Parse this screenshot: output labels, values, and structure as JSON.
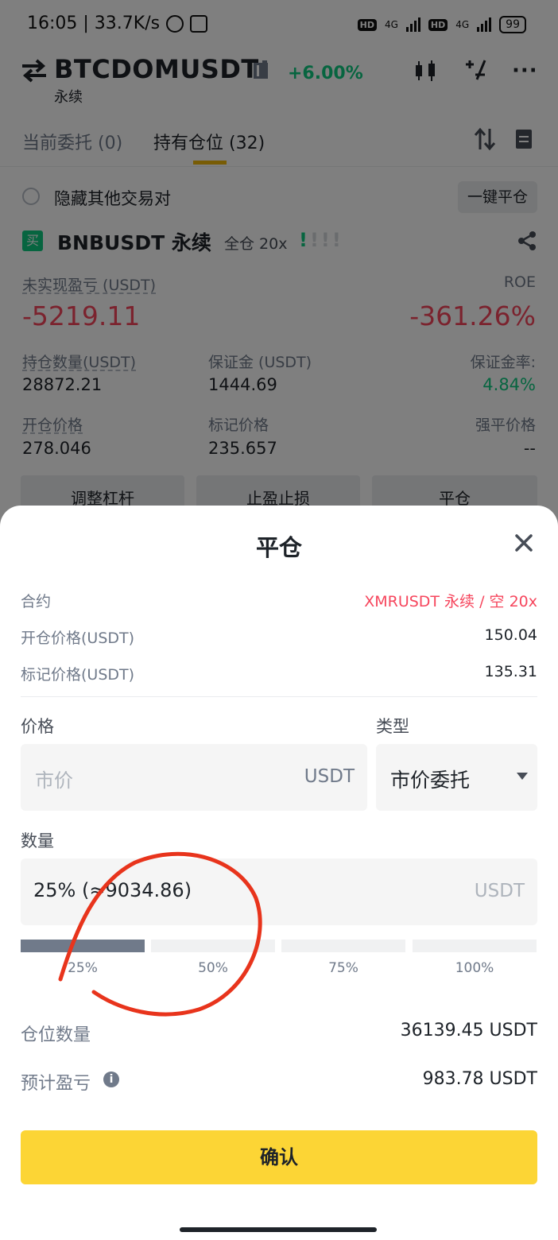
{
  "status_bar": {
    "time_speed": "16:05 | 33.7K/s",
    "hd1": "HD",
    "net1": "4G",
    "hd2": "HD",
    "net2": "4G",
    "battery": "99"
  },
  "header": {
    "pair": "BTCDOMUSDT",
    "subtitle": "永续",
    "change": "+6.00%",
    "more": "···"
  },
  "tabs": {
    "open_orders": "当前委托 (0)",
    "positions": "持有仓位 (32)"
  },
  "filter": {
    "hide_label": "隐藏其他交易对",
    "close_all": "一键平仓"
  },
  "position": {
    "badge": "买",
    "symbol": "BNBUSDT 永续",
    "mode": "全仓 20x",
    "risk_on": "!",
    "risk_off": "!!!",
    "unrealized_label": "未实现盈亏 (USDT)",
    "unrealized_value": "-5219.11",
    "roe_label": "ROE",
    "roe_value": "-361.26%",
    "size_label": "持仓数量(USDT)",
    "size_value": "28872.21",
    "margin_label": "保证金 (USDT)",
    "margin_value": "1444.69",
    "margin_ratio_label": "保证金率:",
    "margin_ratio_value": "4.84%",
    "entry_label": "开仓价格",
    "entry_value": "278.046",
    "mark_label": "标记价格",
    "mark_value": "235.657",
    "liq_label": "强平价格",
    "liq_value": "--",
    "btn_leverage": "调整杠杆",
    "btn_tpsl": "止盈止损",
    "btn_close": "平仓"
  },
  "sheet": {
    "title": "平仓",
    "contract_label": "合约",
    "contract_value": "XMRUSDT 永续 / 空 20x",
    "entry_label": "开仓价格(USDT)",
    "entry_value": "150.04",
    "mark_label": "标记价格(USDT)",
    "mark_value": "135.31",
    "price_label": "价格",
    "price_placeholder": "市价",
    "price_unit": "USDT",
    "type_label": "类型",
    "type_value": "市价委托",
    "qty_label": "数量",
    "qty_value": "25% (≈9034.86)",
    "qty_unit": "USDT",
    "qty_fraction": 0.25,
    "slider_labels": [
      "25%",
      "50%",
      "75%",
      "100%"
    ],
    "position_size_label": "仓位数量",
    "position_size_value": "36139.45 USDT",
    "est_pnl_label": "预计盈亏",
    "est_pnl_value": "983.78 USDT",
    "confirm": "确认"
  },
  "colors": {
    "green": "#0ecb81",
    "red": "#f6465d",
    "yellow": "#fcd535",
    "annotation_red": "#e8341c"
  }
}
